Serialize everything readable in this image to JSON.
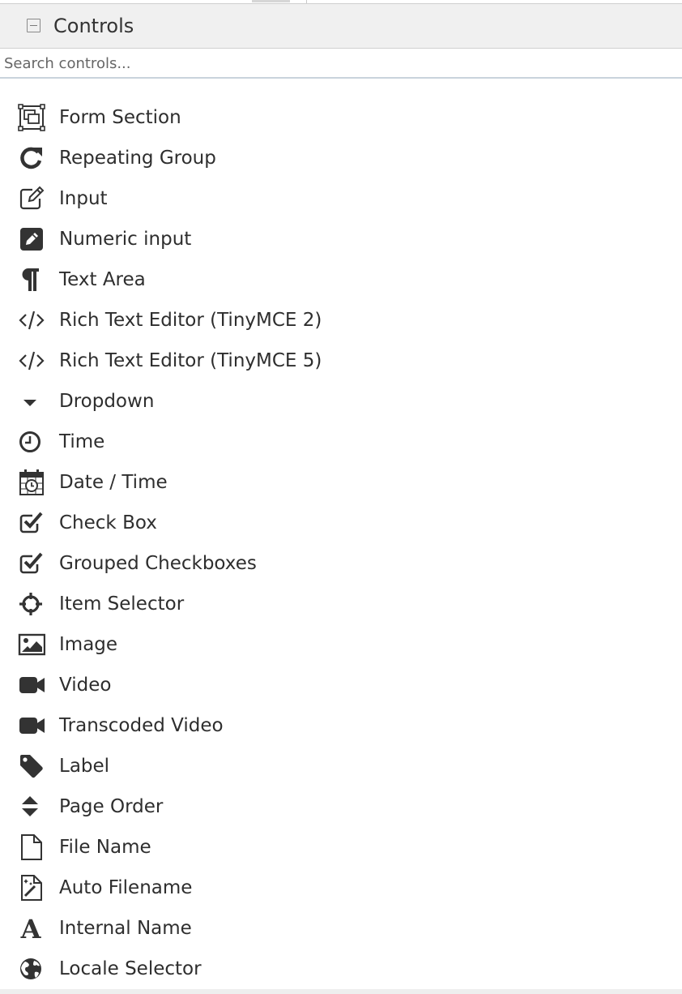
{
  "panel": {
    "title": "Controls",
    "collapse_icon": "minus-square-icon"
  },
  "search": {
    "placeholder": "Search controls...",
    "value": ""
  },
  "controls": [
    {
      "label": "Form Section",
      "icon": "form-section-icon"
    },
    {
      "label": "Repeating Group",
      "icon": "repeat-icon"
    },
    {
      "label": "Input",
      "icon": "edit-icon"
    },
    {
      "label": "Numeric input",
      "icon": "pencil-square-icon"
    },
    {
      "label": "Text Area",
      "icon": "paragraph-icon"
    },
    {
      "label": "Rich Text Editor (TinyMCE 2)",
      "icon": "code-icon"
    },
    {
      "label": "Rich Text Editor (TinyMCE 5)",
      "icon": "code-icon"
    },
    {
      "label": "Dropdown",
      "icon": "caret-down-icon"
    },
    {
      "label": "Time",
      "icon": "clock-icon"
    },
    {
      "label": "Date / Time",
      "icon": "calendar-clock-icon"
    },
    {
      "label": "Check Box",
      "icon": "check-square-icon"
    },
    {
      "label": "Grouped Checkboxes",
      "icon": "check-square-icon"
    },
    {
      "label": "Item Selector",
      "icon": "crosshairs-icon"
    },
    {
      "label": "Image",
      "icon": "image-icon"
    },
    {
      "label": "Video",
      "icon": "video-camera-icon"
    },
    {
      "label": "Transcoded Video",
      "icon": "video-camera-icon"
    },
    {
      "label": "Label",
      "icon": "tag-icon"
    },
    {
      "label": "Page Order",
      "icon": "sort-icon"
    },
    {
      "label": "File Name",
      "icon": "file-icon"
    },
    {
      "label": "Auto Filename",
      "icon": "magic-file-icon"
    },
    {
      "label": "Internal Name",
      "icon": "font-icon"
    },
    {
      "label": "Locale Selector",
      "icon": "globe-icon"
    }
  ],
  "colors": {
    "header_bg": "#f0f0f0",
    "icon": "#333333",
    "text": "#2e2e2e",
    "search_border": "#c9d3dc"
  }
}
